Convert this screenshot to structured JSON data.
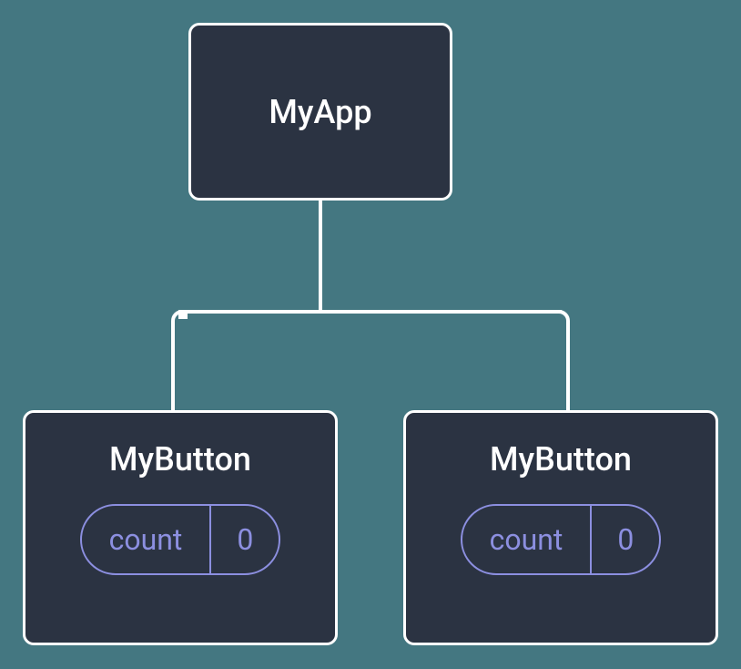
{
  "diagram": {
    "root": {
      "title": "MyApp"
    },
    "children": [
      {
        "title": "MyButton",
        "state": {
          "label": "count",
          "value": "0"
        }
      },
      {
        "title": "MyButton",
        "state": {
          "label": "count",
          "value": "0"
        }
      }
    ]
  }
}
